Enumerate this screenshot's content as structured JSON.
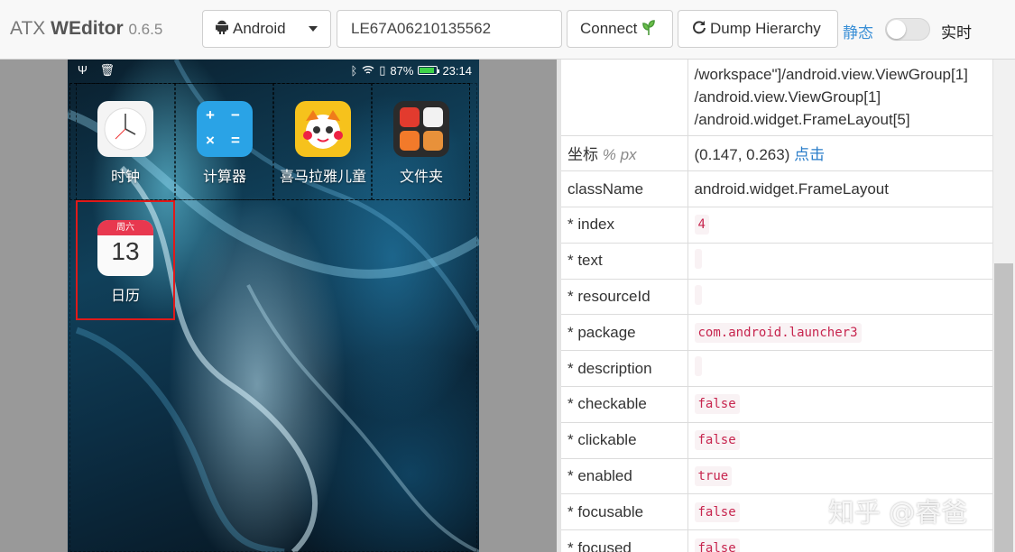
{
  "header": {
    "brand_prefix": "ATX",
    "brand_name": "WEditor",
    "version": "0.6.5",
    "platform": "Android",
    "platform_icon": "android-icon",
    "serial": "LE67A06210135562",
    "connect_label": "Connect",
    "connect_icon": "sprout-icon",
    "dump_label": "Dump Hierarchy",
    "dump_icon": "refresh-icon",
    "mode_static": "静态",
    "mode_live": "实时",
    "live_enabled": false
  },
  "phone": {
    "status": {
      "left_icons": "Ψ 🗑",
      "battery_text": "87%",
      "battery_level": 0.87,
      "time": "23:14"
    },
    "apps": [
      {
        "label": "时钟"
      },
      {
        "label": "计算器"
      },
      {
        "label": "喜马拉雅儿童"
      },
      {
        "label": "文件夹"
      },
      {
        "label": "日历",
        "cal_weekday": "周六",
        "cal_day": "13"
      }
    ]
  },
  "properties": {
    "xpath_lines": [
      "/workspace\"]/android.view.ViewGroup[1]",
      "/android.view.ViewGroup[1]",
      "/android.widget.FrameLayout[5]"
    ],
    "coord_label": "坐标",
    "coord_unit_pct": "%",
    "coord_unit_px": "px",
    "coord_value": "(0.147, 0.263)",
    "coord_link": "点击",
    "rows": [
      {
        "key": "className",
        "value": "android.widget.FrameLayout",
        "code": false
      },
      {
        "key": "* index",
        "value": "4",
        "code": true
      },
      {
        "key": "* text",
        "value": "",
        "code": true
      },
      {
        "key": "* resourceId",
        "value": "",
        "code": true
      },
      {
        "key": "* package",
        "value": "com.android.launcher3",
        "code": true
      },
      {
        "key": "* description",
        "value": "",
        "code": true
      },
      {
        "key": "* checkable",
        "value": "false",
        "code": true
      },
      {
        "key": "* clickable",
        "value": "false",
        "code": true
      },
      {
        "key": "* enabled",
        "value": "true",
        "code": true
      },
      {
        "key": "* focusable",
        "value": "false",
        "code": true
      },
      {
        "key": "* focused",
        "value": "false",
        "code": true
      }
    ]
  },
  "watermark": "知乎 @睿爸",
  "colors": {
    "accent": "#3a8fd6",
    "selection": "#e01a1a",
    "code_text": "#c7254e"
  }
}
